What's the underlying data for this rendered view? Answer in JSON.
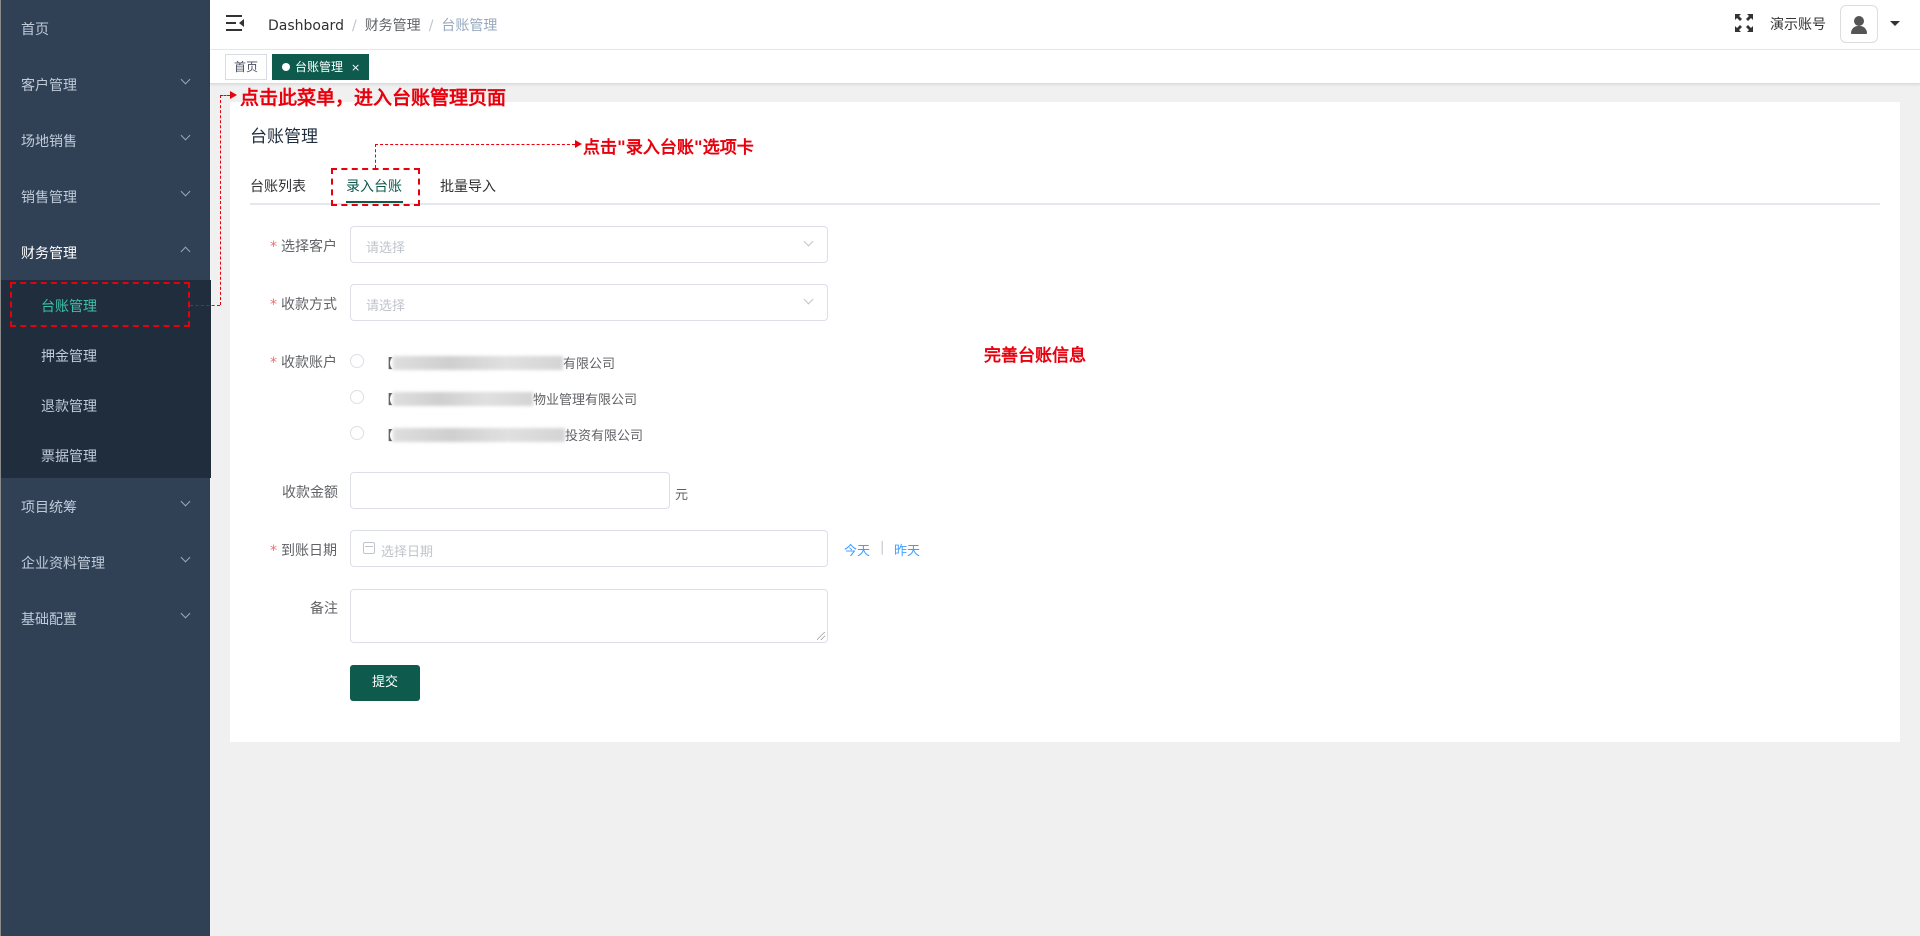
{
  "sidebar": {
    "items": [
      {
        "label": "首页"
      },
      {
        "label": "客户管理"
      },
      {
        "label": "场地销售"
      },
      {
        "label": "销售管理"
      },
      {
        "label": "财务管理"
      },
      {
        "label": "项目统筹"
      },
      {
        "label": "企业资料管理"
      },
      {
        "label": "基础配置"
      }
    ],
    "finance_sub": [
      {
        "label": "台账管理"
      },
      {
        "label": "押金管理"
      },
      {
        "label": "退款管理"
      },
      {
        "label": "票据管理"
      }
    ]
  },
  "navbar": {
    "breadcrumb": [
      "Dashboard",
      "财务管理",
      "台账管理"
    ],
    "separator": "/",
    "account_name": "演示账号"
  },
  "tags": {
    "home": "首页",
    "active": "台账管理",
    "close": "×"
  },
  "page": {
    "title": "台账管理",
    "tabs": [
      "台账列表",
      "录入台账",
      "批量导入"
    ],
    "active_tab": "录入台账"
  },
  "form": {
    "required_mark": "*",
    "customer_label": "选择客户",
    "customer_placeholder": "请选择",
    "method_label": "收款方式",
    "method_placeholder": "请选择",
    "account_label": "收款账户",
    "accounts": [
      {
        "prefix": "【",
        "suffix": "有限公司"
      },
      {
        "prefix": "【",
        "suffix": "物业管理有限公司"
      },
      {
        "prefix": "【",
        "suffix": "投资有限公司"
      }
    ],
    "amount_label": "收款金额",
    "amount_unit": "元",
    "date_label": "到账日期",
    "date_placeholder": "选择日期",
    "today_link": "今天",
    "link_sep": "|",
    "yesterday_link": "昨天",
    "remark_label": "备注",
    "submit_label": "提交"
  },
  "annotations": {
    "menu_hint": "点击此菜单，进入台账管理页面",
    "tab_hint": "点击\"录入台账\"选项卡",
    "form_hint": "完善台账信息",
    "color": "#e8000d"
  },
  "colors": {
    "sidebar_bg": "#304156",
    "primary": "#0e5b4e",
    "active_menu_text": "#3ec1a8",
    "link": "#409eff"
  }
}
